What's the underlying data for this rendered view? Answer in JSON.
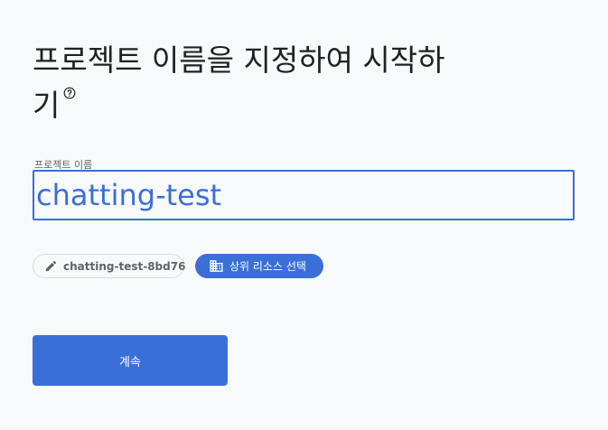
{
  "header": {
    "title": "프로젝트 이름을 지정하여 시작하기",
    "help_icon": "help-circle-icon"
  },
  "project_name_field": {
    "label": "프로젝트 이름",
    "value": "chatting-test"
  },
  "chips": {
    "project_id": {
      "icon": "edit-pencil-icon",
      "label": "chatting-test-8bd76"
    },
    "parent_resource": {
      "icon": "domain-building-icon",
      "label": "상위 리소스 선택"
    }
  },
  "actions": {
    "continue_label": "계속"
  },
  "colors": {
    "accent": "#3a6fd8",
    "background": "#f8f9fa",
    "text_primary": "#202124",
    "text_secondary": "#5f6368"
  }
}
